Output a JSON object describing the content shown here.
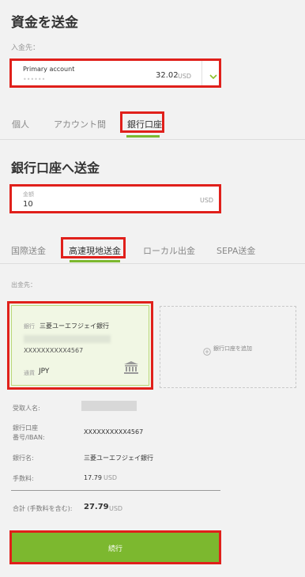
{
  "page": {
    "title": "資金を送金",
    "deposit_label": "入金先："
  },
  "account_select": {
    "name": "Primary account",
    "masked_number": "••••••",
    "balance": "32.02",
    "currency": "USD"
  },
  "method_tabs": [
    {
      "label": "個人"
    },
    {
      "label": "アカウント間"
    },
    {
      "label": "銀行口座"
    }
  ],
  "section_title": "銀行口座へ送金",
  "amount": {
    "label": "金額",
    "value": "10",
    "currency": "USD"
  },
  "transfer_tabs": [
    {
      "label": "国際送金"
    },
    {
      "label": "高速現地送金"
    },
    {
      "label": "ローカル出金"
    },
    {
      "label": "SEPA送金"
    }
  ],
  "destination_label": "出金先：",
  "bank_card": {
    "bank_prefix": "銀行",
    "bank_name": "三菱ユーエフジェイ銀行",
    "account_number": "XXXXXXXXXX4567",
    "currency_label": "通貨",
    "currency": "JPY"
  },
  "add_bank_label": "銀行口座を追加",
  "details": {
    "recipient_label": "受取人名:",
    "account_label_line1": "銀行口座",
    "account_label_line2": "番号/IBAN:",
    "account_value": "XXXXXXXXXX4567",
    "bank_label": "銀行名:",
    "bank_value": "三菱ユーエフジェイ銀行",
    "fee_label": "手数料:",
    "fee_value": "17.79",
    "fee_currency": "USD",
    "total_label": "合計 (手数料を含む):",
    "total_value": "27.79",
    "total_currency": "USD"
  },
  "continue_label": "続行",
  "colors": {
    "accent": "#7cb82f",
    "highlight": "#e0201b",
    "card_bg": "#f1f7e4"
  }
}
